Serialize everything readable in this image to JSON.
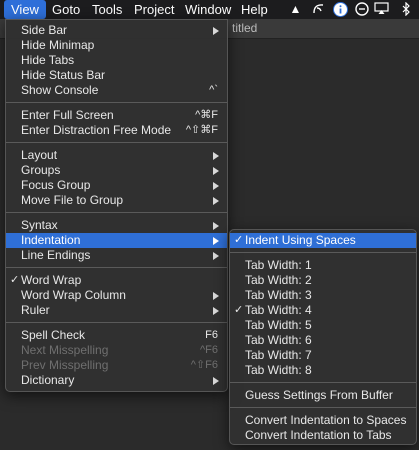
{
  "menubar": {
    "items": [
      "View",
      "Goto",
      "Tools",
      "Project",
      "Window",
      "Help"
    ],
    "active": "View",
    "status_icons": [
      "triangle-icon",
      "curl-icon",
      "info-icon",
      "circle-x-icon",
      "sync-icon",
      "airplay-icon",
      "display-icon",
      "bluetooth-icon"
    ]
  },
  "window": {
    "title_fragment": "titled"
  },
  "view_menu": {
    "items": [
      {
        "label": "Side Bar",
        "shortcut": "",
        "submenu": true
      },
      {
        "label": "Hide Minimap",
        "shortcut": ""
      },
      {
        "label": "Hide Tabs",
        "shortcut": ""
      },
      {
        "label": "Hide Status Bar",
        "shortcut": ""
      },
      {
        "label": "Show Console",
        "shortcut": "^`"
      },
      {
        "label": "Enter Full Screen",
        "shortcut": "^⌘F"
      },
      {
        "label": "Enter Distraction Free Mode",
        "shortcut": "^⇧⌘F"
      },
      {
        "label": "Layout",
        "shortcut": "",
        "submenu": true
      },
      {
        "label": "Groups",
        "shortcut": "",
        "submenu": true
      },
      {
        "label": "Focus Group",
        "shortcut": "",
        "submenu": true
      },
      {
        "label": "Move File to Group",
        "shortcut": "",
        "submenu": true
      },
      {
        "label": "Syntax",
        "shortcut": "",
        "submenu": true
      },
      {
        "label": "Indentation",
        "shortcut": "",
        "submenu": true,
        "highlighted": true
      },
      {
        "label": "Line Endings",
        "shortcut": "",
        "submenu": true
      },
      {
        "label": "Word Wrap",
        "shortcut": "",
        "checked": true
      },
      {
        "label": "Word Wrap Column",
        "shortcut": "",
        "submenu": true
      },
      {
        "label": "Ruler",
        "shortcut": "",
        "submenu": true
      },
      {
        "label": "Spell Check",
        "shortcut": "F6"
      },
      {
        "label": "Next Misspelling",
        "shortcut": "^F6",
        "disabled": true
      },
      {
        "label": "Prev Misspelling",
        "shortcut": "^⇧F6",
        "disabled": true
      },
      {
        "label": "Dictionary",
        "shortcut": "",
        "submenu": true
      }
    ]
  },
  "indent_menu": {
    "items": [
      {
        "label": "Indent Using Spaces",
        "checked": true,
        "highlighted": true
      },
      {
        "label": "Tab Width: 1"
      },
      {
        "label": "Tab Width: 2"
      },
      {
        "label": "Tab Width: 3"
      },
      {
        "label": "Tab Width: 4",
        "checked": true
      },
      {
        "label": "Tab Width: 5"
      },
      {
        "label": "Tab Width: 6"
      },
      {
        "label": "Tab Width: 7"
      },
      {
        "label": "Tab Width: 8"
      },
      {
        "label": "Guess Settings From Buffer"
      },
      {
        "label": "Convert Indentation to Spaces"
      },
      {
        "label": "Convert Indentation to Tabs"
      }
    ]
  }
}
